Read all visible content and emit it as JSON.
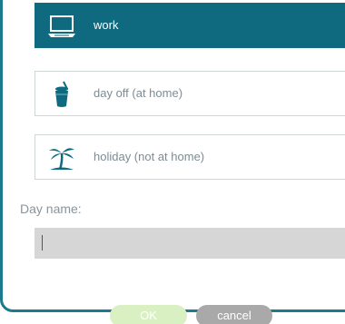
{
  "options": [
    {
      "label": "work",
      "icon": "laptop-icon",
      "selected": true
    },
    {
      "label": "day off (at home)",
      "icon": "drink-cup-icon",
      "selected": false
    },
    {
      "label": "holiday (not at home)",
      "icon": "palm-tree-icon",
      "selected": false
    }
  ],
  "day_name": {
    "label": "Day name:",
    "value": ""
  },
  "buttons": {
    "ok_label": "OK",
    "cancel_label": "cancel"
  },
  "colors": {
    "accent": "#0f6a7f",
    "frame": "#1b7a8c",
    "ok_disabled": "#d9f0c3",
    "cancel": "#a9a9a9"
  }
}
